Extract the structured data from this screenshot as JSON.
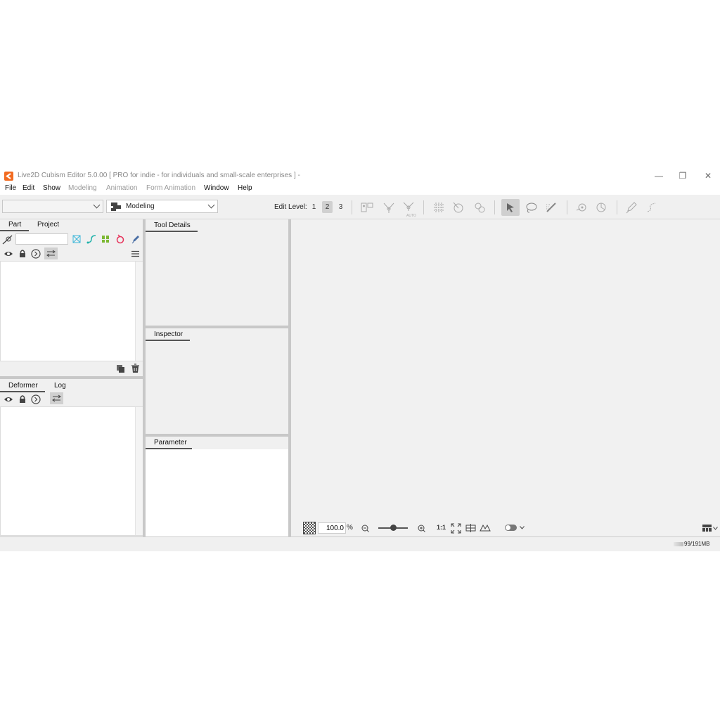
{
  "window": {
    "title": "Live2D Cubism Editor 5.0.00    [ PRO for indie - for individuals and small-scale enterprises ]  -",
    "controls": {
      "minimize": "—",
      "maximize": "❐",
      "close": "✕"
    }
  },
  "menu": {
    "items": [
      {
        "label": "File",
        "enabled": true
      },
      {
        "label": "Edit",
        "enabled": true
      },
      {
        "label": "Show",
        "enabled": true
      },
      {
        "label": "Modeling",
        "enabled": false
      },
      {
        "label": "Animation",
        "enabled": false
      },
      {
        "label": "Form Animation",
        "enabled": false
      },
      {
        "label": "Window",
        "enabled": true
      },
      {
        "label": "Help",
        "enabled": true
      }
    ]
  },
  "toolbar": {
    "document_select": {
      "value": ""
    },
    "workspace_select": {
      "value": "Modeling",
      "icon": "modeling-workspace-icon"
    },
    "edit_level_label": "Edit Level:",
    "edit_levels": [
      "1",
      "2",
      "3"
    ],
    "edit_level_selected": "2",
    "auto_label": "AUTO"
  },
  "part_panel": {
    "tabs": [
      "Part",
      "Project"
    ],
    "active_tab": "Part",
    "search_value": ""
  },
  "tool_details_panel": {
    "tab": "Tool Details"
  },
  "inspector_panel": {
    "tab": "Inspector"
  },
  "parameter_panel": {
    "tab": "Parameter"
  },
  "deformer_panel": {
    "tabs": [
      "Deformer",
      "Log"
    ],
    "active_tab": "Deformer"
  },
  "viewport": {
    "zoom_value": "100.0",
    "zoom_unit": "%",
    "zoom_slider_level": 0.5,
    "one_to_one_label": "1:1"
  },
  "status": {
    "memory": "99/191MB"
  },
  "colors": {
    "brand_orange": "#f26b21",
    "panel_bg": "#f0f0f0",
    "divider": "#c8c8c8"
  }
}
